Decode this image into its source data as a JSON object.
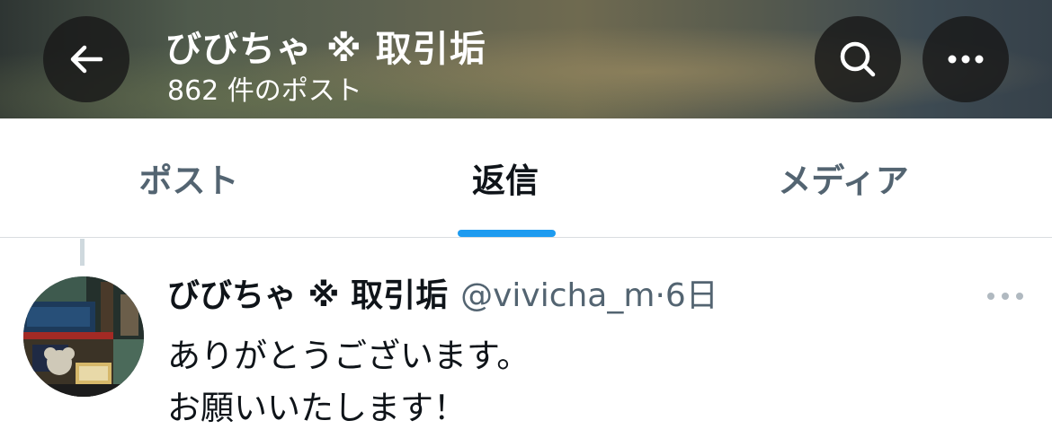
{
  "header": {
    "title": "びびちゃ ※ 取引垢",
    "post_count": "862 件のポスト",
    "back_icon": "arrow-left-icon",
    "search_icon": "search-icon",
    "more_icon": "more-horizontal-icon"
  },
  "tabs": [
    {
      "label": "ポスト",
      "active": false
    },
    {
      "label": "返信",
      "active": true
    },
    {
      "label": "メディア",
      "active": false
    }
  ],
  "colors": {
    "accent": "#1d9bf0",
    "text_primary": "#0f1419",
    "text_secondary": "#536471"
  },
  "tweet": {
    "display_name": "びびちゃ ※ 取引垢",
    "handle": "@vivicha_m",
    "separator": "·",
    "time": "6日",
    "lines": [
      "ありがとうございます。",
      "お願いいたします！"
    ],
    "avatar_icon": "avatar-image",
    "more_icon": "more-horizontal-icon"
  }
}
